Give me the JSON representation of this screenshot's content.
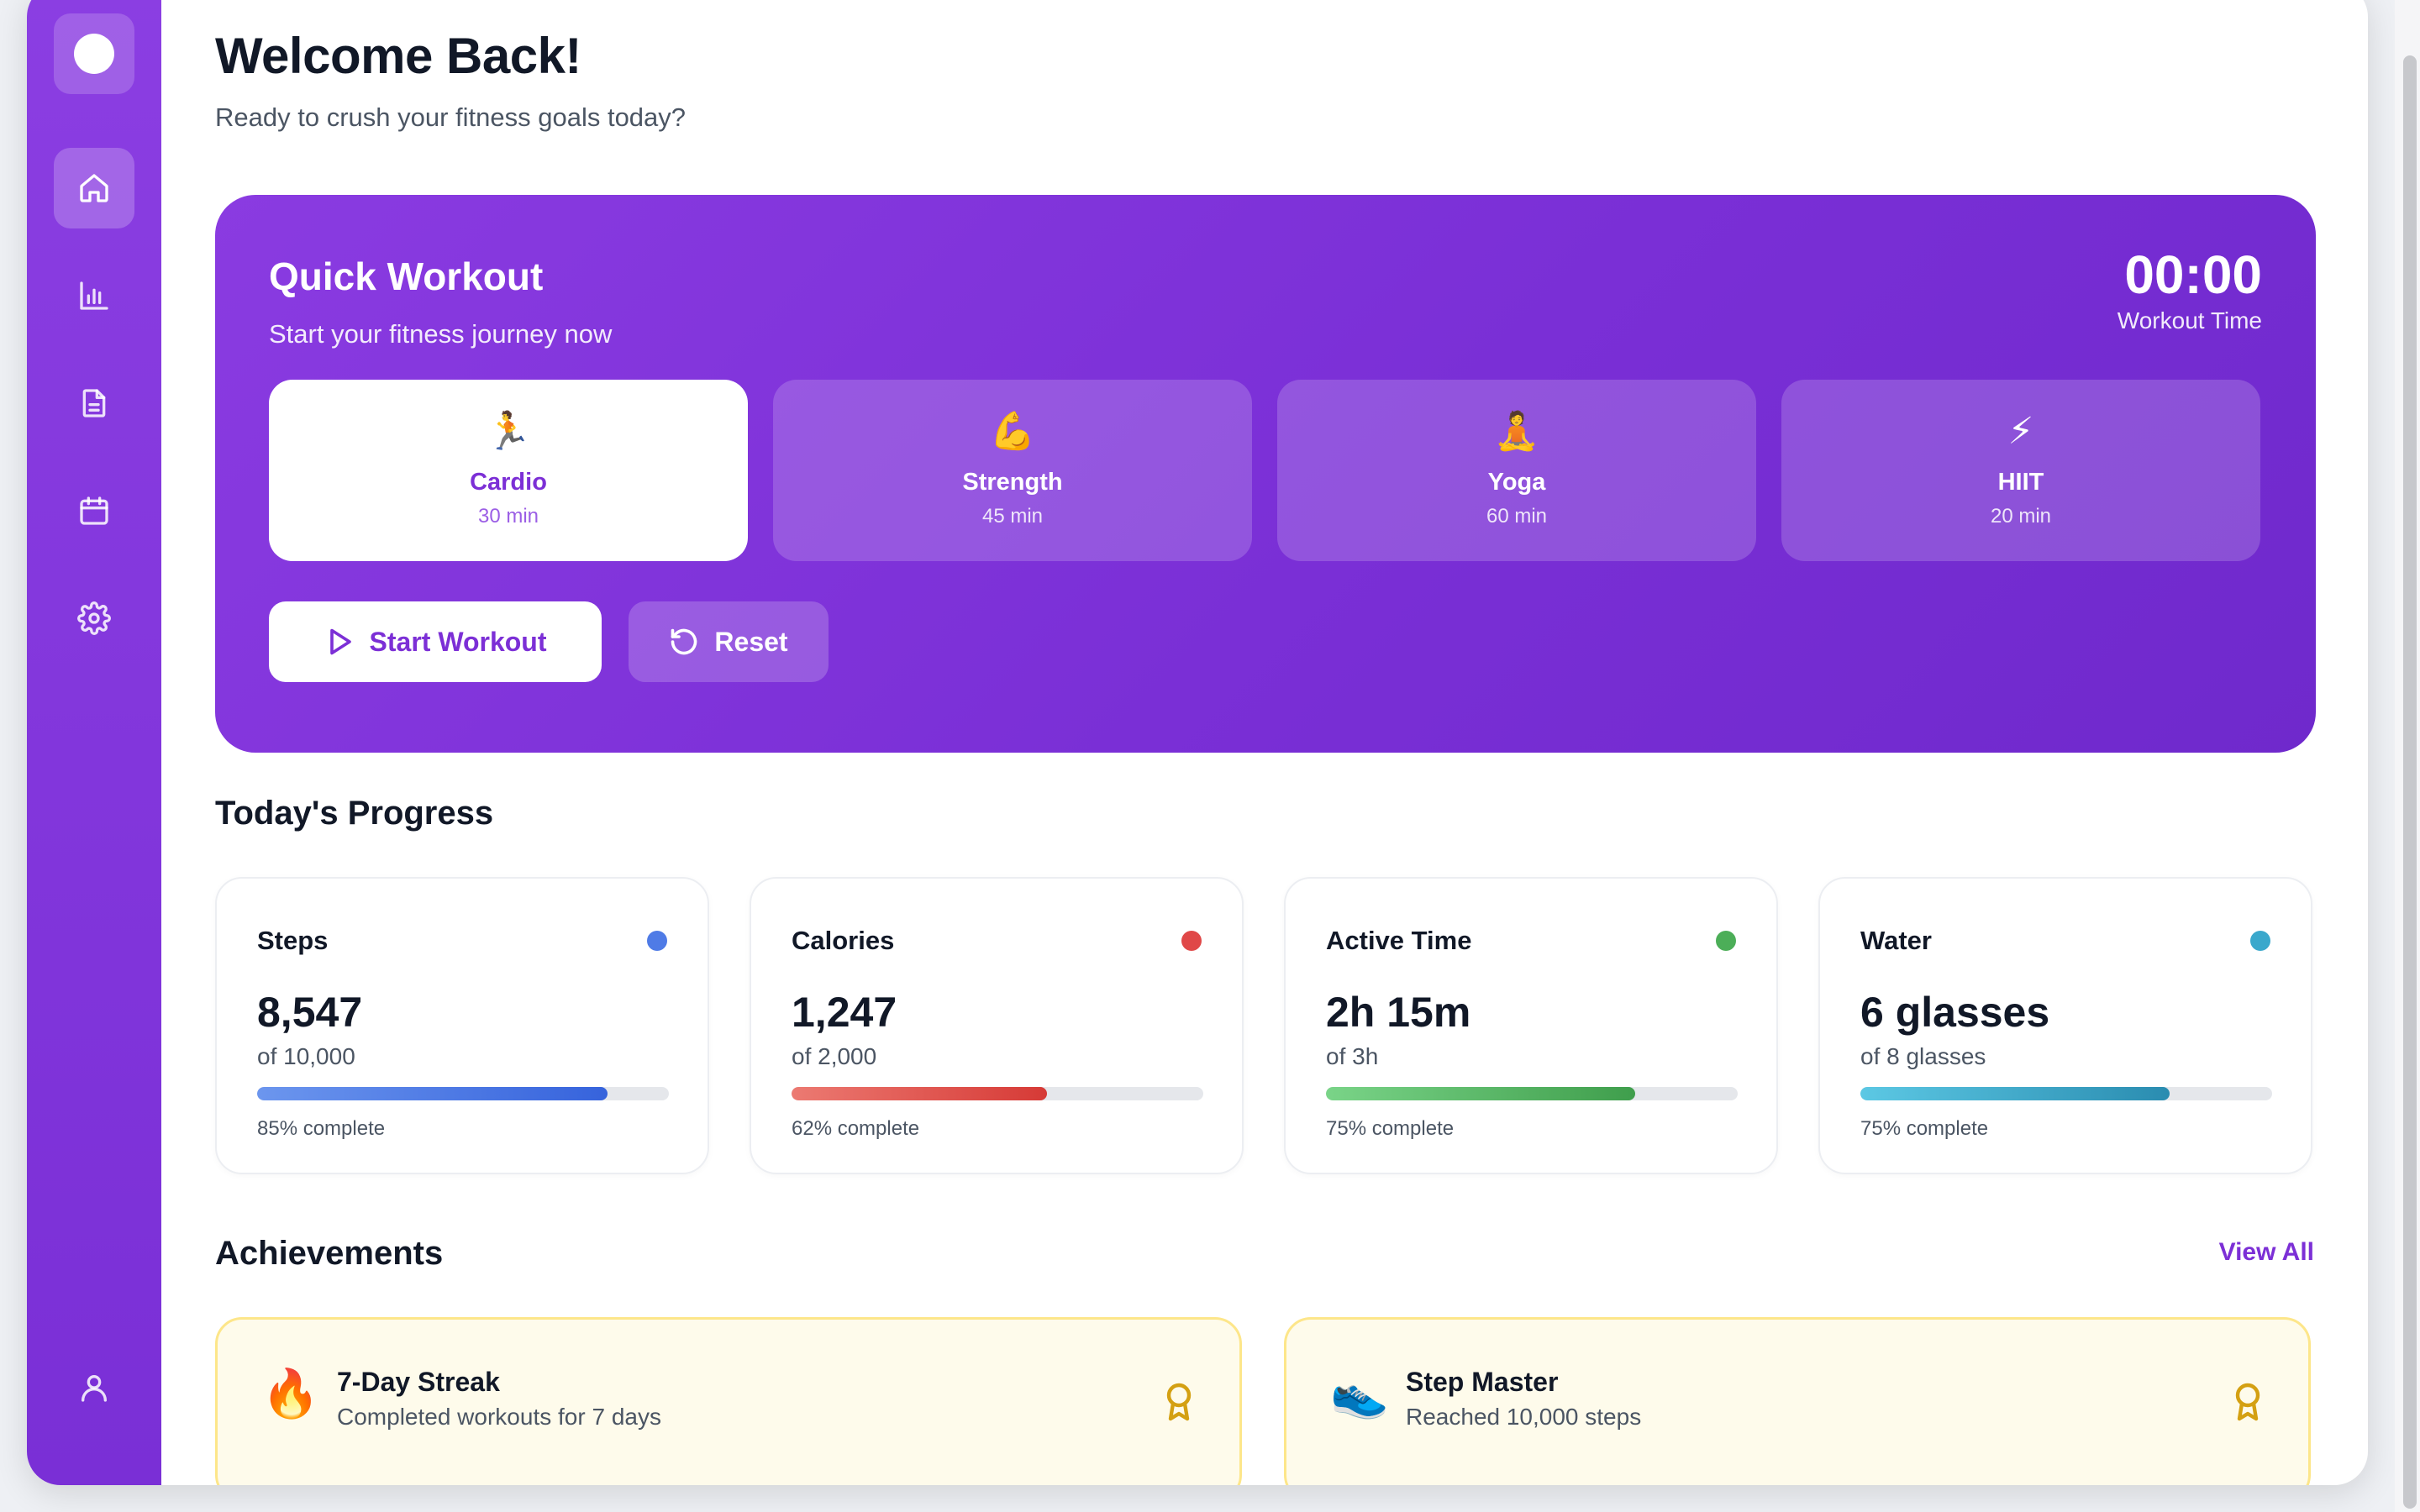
{
  "header": {
    "title": "Welcome Back!",
    "subtitle": "Ready to crush your fitness goals today?"
  },
  "sidebar": {
    "items": [
      {
        "name": "home-icon",
        "active": true
      },
      {
        "name": "chart-icon",
        "active": false
      },
      {
        "name": "document-icon",
        "active": false
      },
      {
        "name": "calendar-icon",
        "active": false
      },
      {
        "name": "settings-icon",
        "active": false
      }
    ],
    "profile_icon": "user-icon"
  },
  "quick_workout": {
    "title": "Quick Workout",
    "subtitle": "Start your fitness journey now",
    "timer": "00:00",
    "timer_label": "Workout Time",
    "types": [
      {
        "emoji": "🏃",
        "name": "Cardio",
        "duration": "30 min",
        "selected": true
      },
      {
        "emoji": "💪",
        "name": "Strength",
        "duration": "45 min",
        "selected": false
      },
      {
        "emoji": "🧘",
        "name": "Yoga",
        "duration": "60 min",
        "selected": false
      },
      {
        "emoji": "⚡",
        "name": "HIIT",
        "duration": "20 min",
        "selected": false
      }
    ],
    "start_label": "Start Workout",
    "reset_label": "Reset"
  },
  "progress": {
    "title": "Today's Progress",
    "stats": [
      {
        "label": "Steps",
        "value": "8,547",
        "goal": "of 10,000",
        "percent_text": "85% complete",
        "percent": 85,
        "color": "#3b6fe0"
      },
      {
        "label": "Calories",
        "value": "1,247",
        "goal": "of 2,000",
        "percent_text": "62% complete",
        "percent": 62,
        "color": "#dc3b3b"
      },
      {
        "label": "Active Time",
        "value": "2h 15m",
        "goal": "of 3h",
        "percent_text": "75% complete",
        "percent": 75,
        "color": "#3fa64c"
      },
      {
        "label": "Water",
        "value": "6 glasses",
        "goal": "of 8 glasses",
        "percent_text": "75% complete",
        "percent": 75,
        "color": "#2fa3c4"
      }
    ]
  },
  "achievements": {
    "title": "Achievements",
    "view_all": "View All",
    "items": [
      {
        "emoji": "🔥",
        "title": "7-Day Streak",
        "description": "Completed workouts for 7 days"
      },
      {
        "emoji": "👟",
        "title": "Step Master",
        "description": "Reached 10,000 steps"
      }
    ]
  }
}
